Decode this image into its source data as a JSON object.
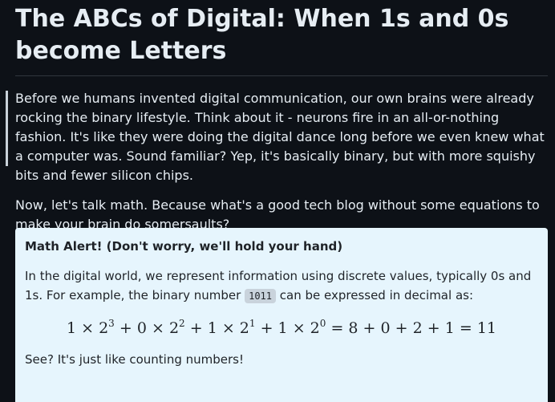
{
  "article": {
    "title": "The ABCs of Digital: When 1s and 0s become Letters",
    "quote": "Before we humans invented digital communication, our own brains were already rocking the binary lifestyle. Think about it - neurons fire in an all-or-nothing fashion. It's like they were doing the digital dance long before we even knew what a computer was. Sound familiar? Yep, it's basically binary, but with more squishy bits and fewer silicon chips.",
    "paragraph": "Now, let's talk math. Because what's a good tech blog without some equations to make your brain do somersaults?"
  },
  "math_alert": {
    "title": "Math Alert! (Don't worry, we'll hold your hand)",
    "text_before_code": "In the digital world, we represent information using discrete values, typically 0s and 1s. For example, the binary number ",
    "code": "1011",
    "text_after_code": " can be expressed in decimal as:",
    "equation": {
      "terms": [
        "1",
        "×",
        "2",
        "3",
        "+",
        "0",
        "×",
        "2",
        "2",
        "+",
        "1",
        "×",
        "2",
        "1",
        "+",
        "1",
        "×",
        "2",
        "0",
        "=",
        "8",
        "+",
        "0",
        "+",
        "2",
        "+",
        "1",
        "=",
        "11"
      ]
    },
    "footer": "See? It's just like counting numbers!"
  }
}
